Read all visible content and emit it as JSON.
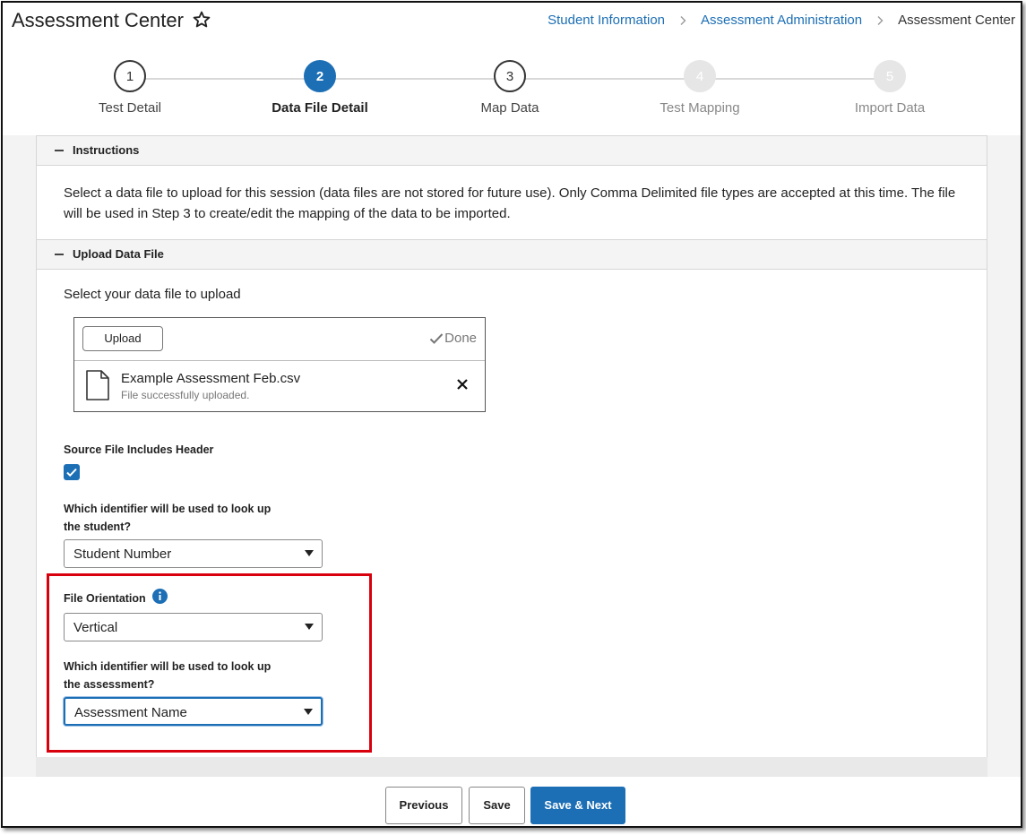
{
  "header": {
    "title": "Assessment Center",
    "breadcrumb": [
      "Student Information",
      "Assessment Administration",
      "Assessment Center"
    ]
  },
  "wizard": {
    "steps": [
      {
        "number": "1",
        "label": "Test Detail",
        "state": "done"
      },
      {
        "number": "2",
        "label": "Data File Detail",
        "state": "active"
      },
      {
        "number": "3",
        "label": "Map Data",
        "state": "done"
      },
      {
        "number": "4",
        "label": "Test Mapping",
        "state": "todo"
      },
      {
        "number": "5",
        "label": "Import Data",
        "state": "todo"
      }
    ]
  },
  "instructions": {
    "title": "Instructions",
    "text": "Select a data file to upload for this session (data files are not stored for future use). Only Comma Delimited file types are accepted at this time. The file will be used in Step 3 to create/edit the mapping of the data to be imported."
  },
  "upload": {
    "section_title": "Upload Data File",
    "prompt": "Select your data file to upload",
    "button_label": "Upload",
    "status_label": "Done",
    "file_name": "Example Assessment Feb.csv",
    "file_status": "File successfully uploaded."
  },
  "form": {
    "header_label": "Source File Includes Header",
    "header_checked": true,
    "student_id_label_line1": "Which identifier will be used to look up",
    "student_id_label_line2": "the student?",
    "student_id_value": "Student Number",
    "orientation_label": "File Orientation",
    "orientation_value": "Vertical",
    "assessment_id_label_line1": "Which identifier will be used to look up",
    "assessment_id_label_line2": "the assessment?",
    "assessment_id_value": "Assessment Name"
  },
  "footer": {
    "previous_label": "Previous",
    "save_label": "Save",
    "save_next_label": "Save & Next"
  },
  "colors": {
    "accent": "#1d6fb5",
    "highlight": "#d9000d"
  }
}
